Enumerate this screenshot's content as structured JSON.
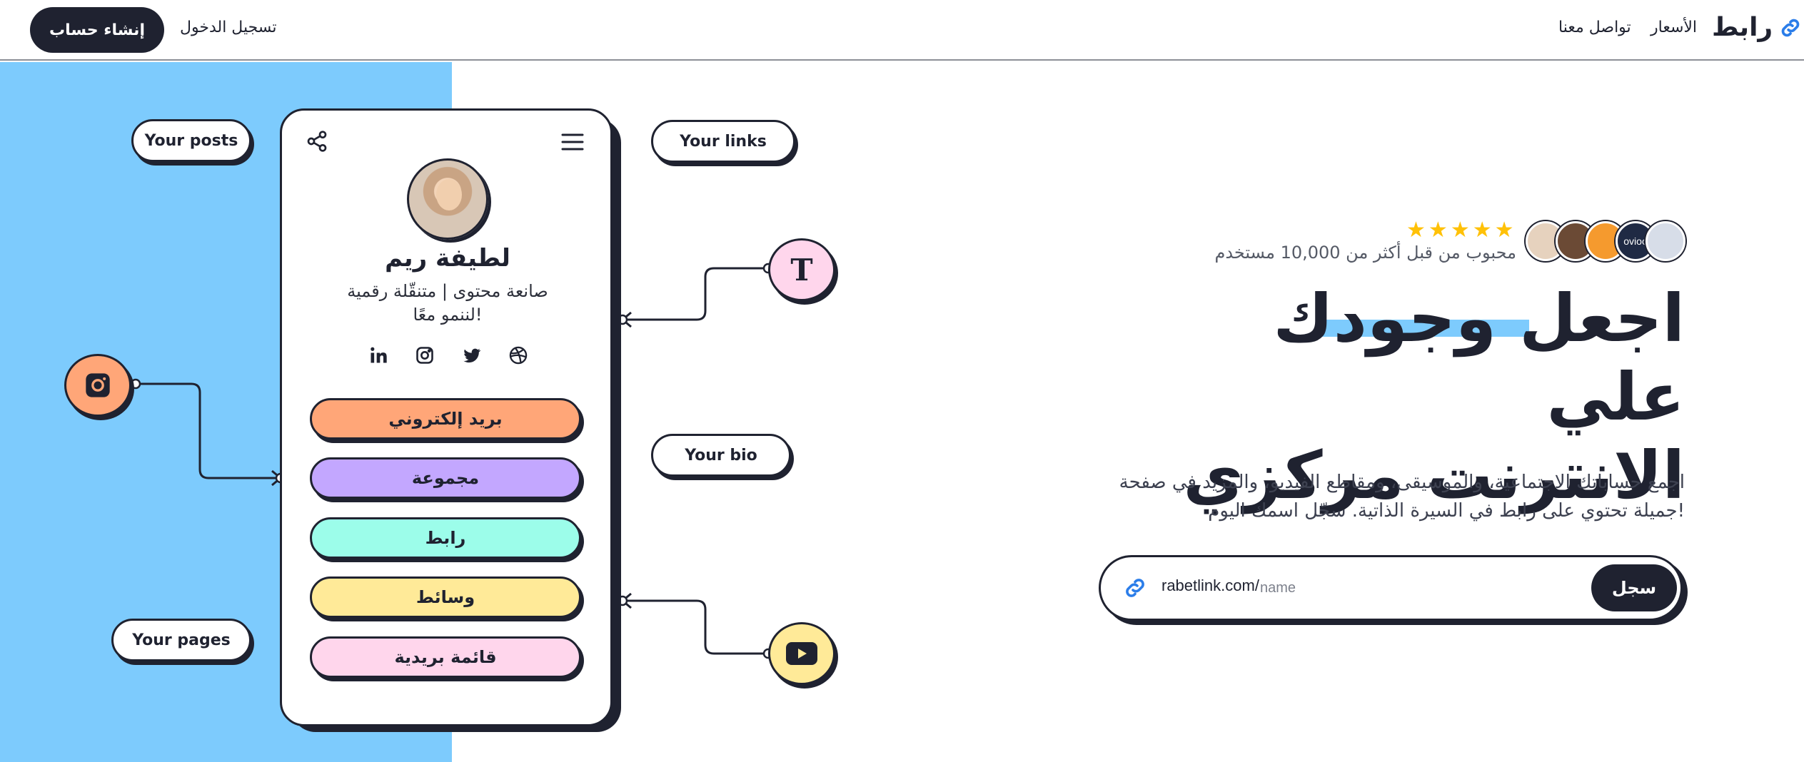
{
  "nav": {
    "brand": "رابط",
    "pricing": "الأسعار",
    "contact": "تواصل معنا",
    "login": "تسجيل الدخول",
    "signup": "إنشاء حساب"
  },
  "colors": {
    "accent_blue": "#7dcbfd",
    "dark": "#1f2230",
    "star": "#ffc107"
  },
  "phone": {
    "name": "لطيفة ريم",
    "bio_line1": "صانعة محتوى | متنقّلة رقمية",
    "bio_line2": "لننمو معًا!",
    "socials": [
      "linkedin-icon",
      "instagram-icon",
      "twitter-icon",
      "dribbble-icon"
    ],
    "links": [
      "بريد إلكتروني",
      "مجموعة",
      "رابط",
      "وسائط",
      "قائمة بريدية"
    ]
  },
  "bubbles": {
    "posts": "Your posts",
    "links": "Your links",
    "bio": "Your bio",
    "pages": "Your pages"
  },
  "hero": {
    "stars": [
      "★",
      "★",
      "★",
      "★",
      "★"
    ],
    "rating": 5,
    "loved_by": "محبوب من قبل أكثر من 10,000 مستخدم",
    "title_line1": "اجعل وجودك علي",
    "title_line2": "الانترنت مركزي",
    "description": "اجمع حساباتك الاجتماعية، والموسيقى، ومقاطع الفيديو، والمزيد في صفحة جميلة تحتوي على رابط في السيرة الذاتية. سجّل اسمك اليوم!",
    "url_prefix": "rabetlink.com/",
    "url_placeholder": "name",
    "submit": "سجل",
    "avatar_badge": "ovioo"
  }
}
